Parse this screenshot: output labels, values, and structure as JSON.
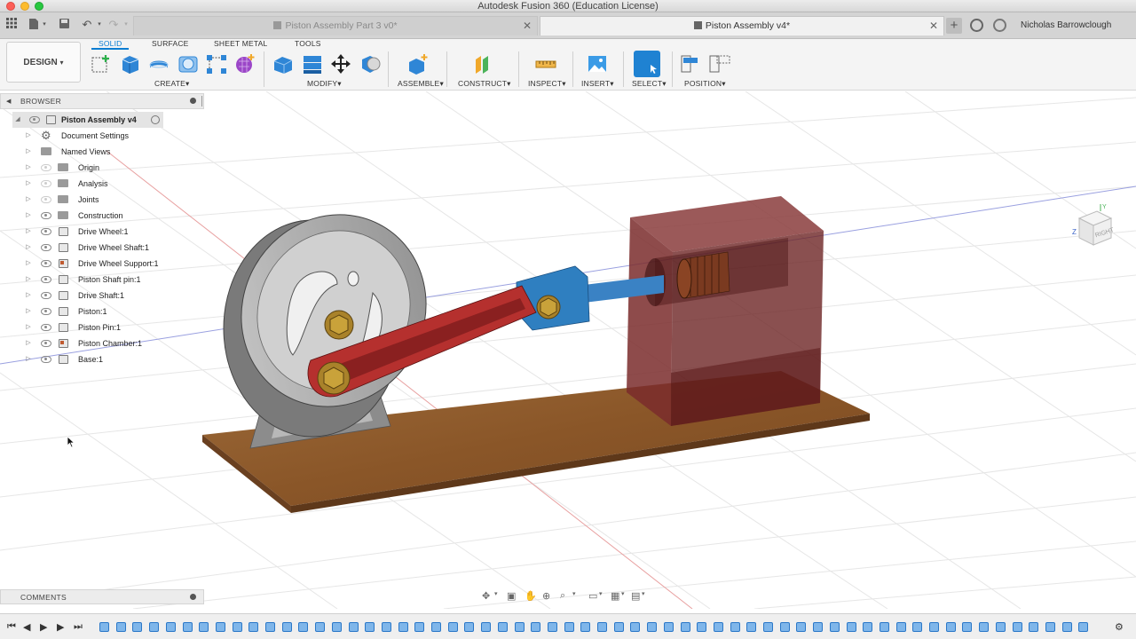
{
  "window": {
    "title": "Autodesk Fusion 360 (Education License)"
  },
  "tabs": {
    "inactive": {
      "label": "Piston Assembly Part 3 v0*"
    },
    "active": {
      "label": "Piston Assembly v4*"
    },
    "user": "Nicholas Barrowclough"
  },
  "toolbar": {
    "workspace": "DESIGN",
    "ws_tabs": [
      "SOLID",
      "SURFACE",
      "SHEET METAL",
      "TOOLS"
    ],
    "groups": [
      "CREATE",
      "MODIFY",
      "ASSEMBLE",
      "CONSTRUCT",
      "INSPECT",
      "INSERT",
      "SELECT",
      "POSITION"
    ]
  },
  "browser": {
    "header": "BROWSER",
    "root": "Piston Assembly v4",
    "items": [
      {
        "label": "Document Settings",
        "icon": "gear-icon"
      },
      {
        "label": "Named Views",
        "icon": "folder-icon"
      },
      {
        "label": "Origin",
        "icon": "folder-icon"
      },
      {
        "label": "Analysis",
        "icon": "folder-icon"
      },
      {
        "label": "Joints",
        "icon": "folder-icon"
      },
      {
        "label": "Construction",
        "icon": "folder-icon"
      },
      {
        "label": "Drive Wheel:1",
        "icon": "component-icon"
      },
      {
        "label": "Drive Wheel Shaft:1",
        "icon": "component-icon"
      },
      {
        "label": "Drive Wheel Support:1",
        "icon": "component-icon"
      },
      {
        "label": "Piston Shaft pin:1",
        "icon": "component-icon"
      },
      {
        "label": "Drive Shaft:1",
        "icon": "component-icon"
      },
      {
        "label": "Piston:1",
        "icon": "component-icon"
      },
      {
        "label": "Piston Pin:1",
        "icon": "component-icon"
      },
      {
        "label": "Piston Chamber:1",
        "icon": "component-icon"
      },
      {
        "label": "Base:1",
        "icon": "component-icon"
      }
    ]
  },
  "viewcube": {
    "face": "RIGHT",
    "axis_z": "Z",
    "axis_y": "Y"
  },
  "comments": {
    "header": "COMMENTS"
  },
  "colors": {
    "accent": "#0a7dd2",
    "piston_chamber": "#7a2a2a",
    "rod": "#b5302e",
    "link": "#2f7fc0",
    "base": "#8a5a2e"
  }
}
